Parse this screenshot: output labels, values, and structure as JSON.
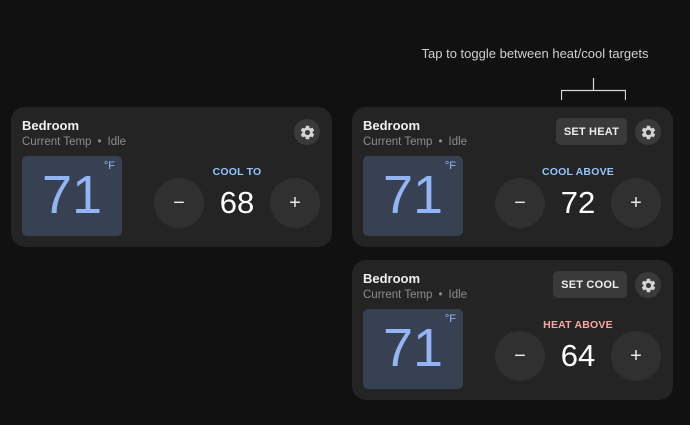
{
  "annotation": "Tap to toggle between heat/cool targets",
  "cards": [
    {
      "title": "Bedroom",
      "current_label": "Current Temp",
      "separator": "•",
      "status": "Idle",
      "current_temp": "71",
      "unit": "°F",
      "mode_label": "COOL TO",
      "setpoint": "68",
      "minus": "−",
      "plus": "+",
      "icons": [
        "gear-icon"
      ]
    },
    {
      "title": "Bedroom",
      "current_label": "Current Temp",
      "separator": "•",
      "status": "Idle",
      "current_temp": "71",
      "unit": "°F",
      "toggle_label": "SET HEAT",
      "mode_label": "COOL ABOVE",
      "setpoint": "72",
      "minus": "−",
      "plus": "+",
      "icons": [
        "gear-icon"
      ]
    },
    {
      "title": "Bedroom",
      "current_label": "Current Temp",
      "separator": "•",
      "status": "Idle",
      "current_temp": "71",
      "unit": "°F",
      "toggle_label": "SET COOL",
      "mode_label": "HEAT ABOVE",
      "setpoint": "64",
      "minus": "−",
      "plus": "+",
      "icons": [
        "gear-icon"
      ]
    }
  ],
  "colors": {
    "background": "#111111",
    "card": "#242424",
    "temp_box": "#374151",
    "temp_text": "#93b4f5",
    "cool_label": "#93c5fd",
    "heat_label": "#fca5a5"
  }
}
